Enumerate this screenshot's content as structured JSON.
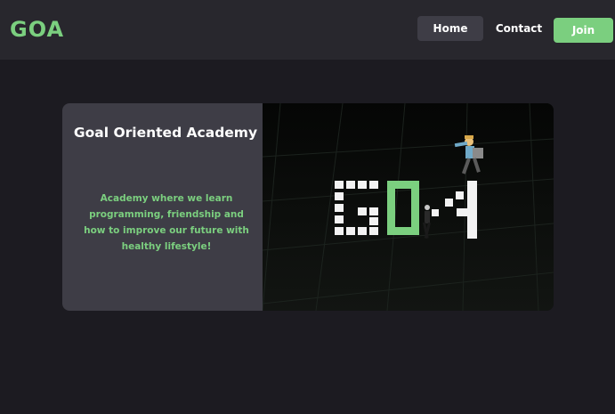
{
  "header": {
    "logo": "GOA",
    "nav": {
      "home": "Home",
      "contact": "Contact",
      "join": "Join"
    }
  },
  "hero": {
    "title": "Goal Oriented Academy",
    "description": "Academy where we learn programming, friendship and how to improve our future with healthy lifestyle!",
    "image": {
      "logo_text": "GOA"
    }
  },
  "colors": {
    "accent": "#7bcf7f",
    "background": "#1c1b21",
    "navbar": "#28272d",
    "panel": "#3e3d46"
  }
}
